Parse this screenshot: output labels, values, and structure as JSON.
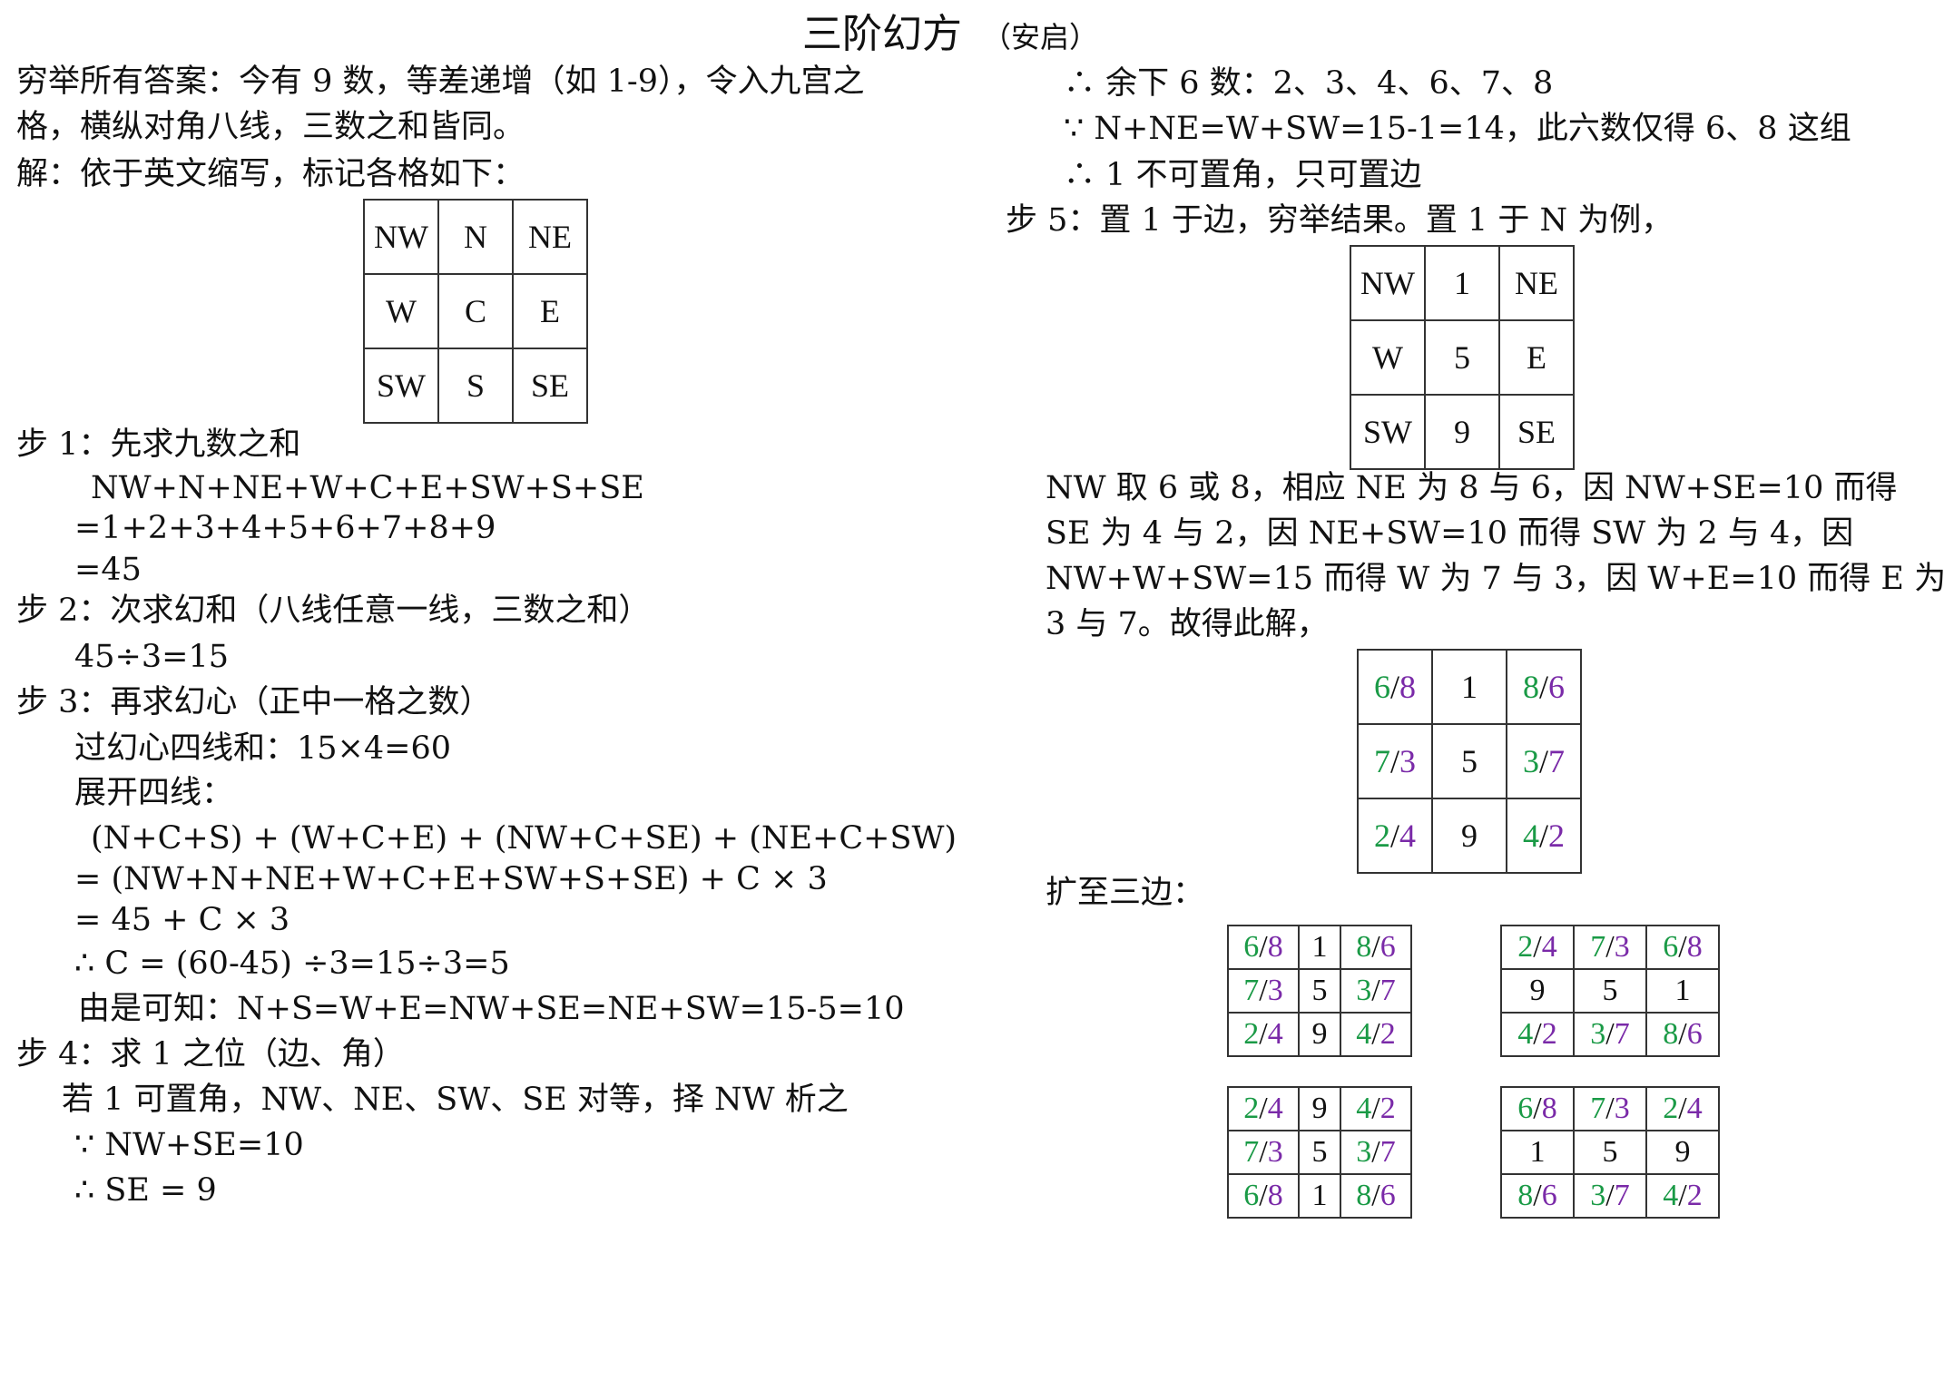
{
  "title": "三阶幻方",
  "title_sub": "（安启）",
  "left": {
    "intro1": "穷举所有答案：今有 9 数，等差递增（如 1-9），令入九宫之",
    "intro2": "格，横纵对角八线，三数之和皆同。",
    "intro3": "解：依于英文缩写，标记各格如下：",
    "label_grid": [
      "NW",
      "N",
      "NE",
      "W",
      "C",
      "E",
      "SW",
      "S",
      "SE"
    ],
    "s1_head": "步 1：先求九数之和",
    "s1_l1": "NW+N+NE+W+C+E+SW+S+SE",
    "s1_l2": "=1+2+3+4+5+6+7+8+9",
    "s1_l3": "=45",
    "s2_head": "步 2：次求幻和（八线任意一线，三数之和）",
    "s2_l1": "45÷3=15",
    "s3_head": "步 3：再求幻心（正中一格之数）",
    "s3_l1": "过幻心四线和：15×4=60",
    "s3_l2": "展开四线：",
    "s3_l3": "(N+C+S) + (W+C+E) + (NW+C+SE) + (NE+C+SW)",
    "s3_l4": "= (NW+N+NE+W+C+E+SW+S+SE) + C × 3",
    "s3_l5": "= 45 + C × 3",
    "s3_l6": "∴  C = (60-45)  ÷3=15÷3=5",
    "s3_l7": "由是可知：N+S=W+E=NW+SE=NE+SW=15-5=10",
    "s4_head": "步 4：求 1 之位（边、角）",
    "s4_l1": "若 1 可置角，NW、NE、SW、SE 对等，择 NW 析之",
    "s4_l2": "∵  NW+SE=10",
    "s4_l3": "∴  SE = 9"
  },
  "right": {
    "r1": "∴  余下 6 数：2、3、4、6、7、8",
    "r2": "∵  N+NE=W+SW=15-1=14，此六数仅得 6、8 这组",
    "r3": "∴  1 不可置角，只可置边",
    "s5_head": "步 5：置 1 于边，穷举结果。置 1 于 N 为例，",
    "grid2": [
      "NW",
      "1",
      "NE",
      "W",
      "5",
      "E",
      "SW",
      "9",
      "SE"
    ],
    "p1": "NW 取 6 或 8，相应 NE 为 8 与 6，因 NW+SE=10 而得",
    "p2": "SE 为 4 与 2，因 NE+SW=10 而得 SW 为 2 与 4，因",
    "p3": "NW+W+SW=15 而得 W 为 7 与 3，因 W+E=10 而得 E 为",
    "p4": "3 与 7。故得此解，",
    "sol": [
      [
        "6",
        "8"
      ],
      "1",
      [
        "8",
        "6"
      ],
      [
        "7",
        "3"
      ],
      "5",
      [
        "3",
        "7"
      ],
      [
        "2",
        "4"
      ],
      "9",
      [
        "4",
        "2"
      ]
    ],
    "expand_head": "扩至三边：",
    "g_a": [
      [
        "6",
        "8"
      ],
      "1",
      [
        "8",
        "6"
      ],
      [
        "7",
        "3"
      ],
      "5",
      [
        "3",
        "7"
      ],
      [
        "2",
        "4"
      ],
      "9",
      [
        "4",
        "2"
      ]
    ],
    "g_b": [
      [
        "2",
        "4"
      ],
      [
        "7",
        "3"
      ],
      [
        "6",
        "8"
      ],
      "9",
      "5",
      "1",
      [
        "4",
        "2"
      ],
      [
        "3",
        "7"
      ],
      [
        "8",
        "6"
      ]
    ],
    "g_c": [
      [
        "2",
        "4"
      ],
      "9",
      [
        "4",
        "2"
      ],
      [
        "7",
        "3"
      ],
      "5",
      [
        "3",
        "7"
      ],
      [
        "6",
        "8"
      ],
      "1",
      [
        "8",
        "6"
      ]
    ],
    "g_d": [
      [
        "6",
        "8"
      ],
      [
        "7",
        "3"
      ],
      [
        "2",
        "4"
      ],
      "1",
      "5",
      "9",
      [
        "8",
        "6"
      ],
      [
        "3",
        "7"
      ],
      [
        "4",
        "2"
      ]
    ]
  },
  "colors": {
    "first": "#1a9a46",
    "second": "#7a2aa8"
  }
}
